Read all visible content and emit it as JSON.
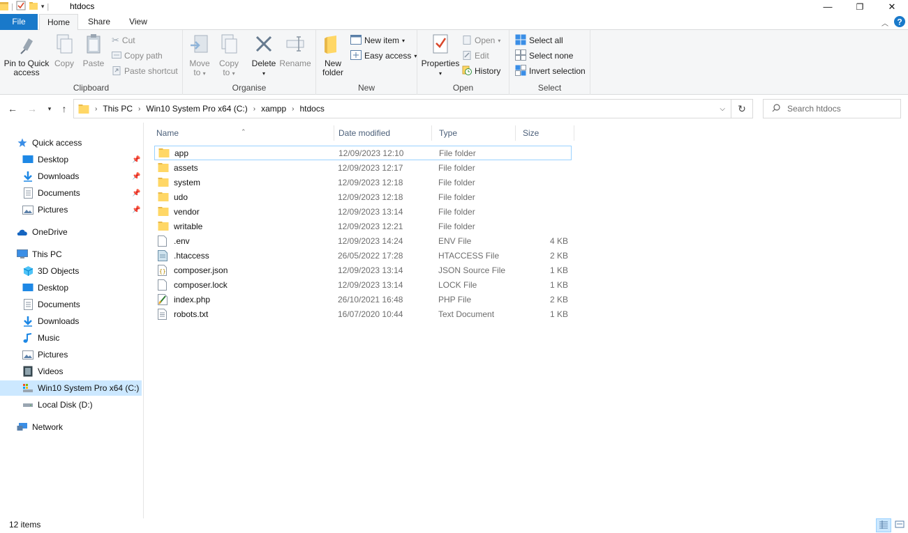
{
  "window": {
    "title": "htdocs",
    "minimize_glyph": "—",
    "maximize_glyph": "❐",
    "close_glyph": "✕"
  },
  "ribbon_tabs": {
    "file": "File",
    "home": "Home",
    "share": "Share",
    "view": "View"
  },
  "ribbon": {
    "clipboard": {
      "label": "Clipboard",
      "pin": [
        "Pin to Quick",
        "access"
      ],
      "copy": "Copy",
      "paste": "Paste",
      "cut": "Cut",
      "copy_path": "Copy path",
      "paste_shortcut": "Paste shortcut"
    },
    "organise": {
      "label": "Organise",
      "move_to": [
        "Move",
        "to"
      ],
      "copy_to": [
        "Copy",
        "to"
      ],
      "delete": "Delete",
      "rename": "Rename"
    },
    "new": {
      "label": "New",
      "new_folder": [
        "New",
        "folder"
      ],
      "new_item": "New item",
      "easy_access": "Easy access"
    },
    "open": {
      "label": "Open",
      "properties": "Properties",
      "open": "Open",
      "edit": "Edit",
      "history": "History"
    },
    "select": {
      "label": "Select",
      "select_all": "Select all",
      "select_none": "Select none",
      "invert_selection": "Invert selection"
    }
  },
  "address": {
    "crumbs": [
      "This PC",
      "Win10 System Pro x64 (C:)",
      "xampp",
      "htdocs"
    ],
    "search_placeholder": "Search htdocs"
  },
  "nav_pane": {
    "quick_access": "Quick access",
    "quick_items": [
      "Desktop",
      "Downloads",
      "Documents",
      "Pictures"
    ],
    "onedrive": "OneDrive",
    "this_pc": "This PC",
    "pc_items": [
      "3D Objects",
      "Desktop",
      "Documents",
      "Downloads",
      "Music",
      "Pictures",
      "Videos",
      "Win10 System Pro x64 (C:)",
      "Local Disk (D:)"
    ],
    "network": "Network"
  },
  "columns": {
    "name": "Name",
    "date": "Date modified",
    "type": "Type",
    "size": "Size"
  },
  "files": [
    {
      "name": "app",
      "date": "12/09/2023 12:10",
      "type": "File folder",
      "size": "",
      "icon": "folder-icon"
    },
    {
      "name": "assets",
      "date": "12/09/2023 12:17",
      "type": "File folder",
      "size": "",
      "icon": "folder-icon"
    },
    {
      "name": "system",
      "date": "12/09/2023 12:18",
      "type": "File folder",
      "size": "",
      "icon": "folder-icon"
    },
    {
      "name": "udo",
      "date": "12/09/2023 12:18",
      "type": "File folder",
      "size": "",
      "icon": "folder-icon"
    },
    {
      "name": "vendor",
      "date": "12/09/2023 13:14",
      "type": "File folder",
      "size": "",
      "icon": "folder-icon"
    },
    {
      "name": "writable",
      "date": "12/09/2023 12:21",
      "type": "File folder",
      "size": "",
      "icon": "folder-icon"
    },
    {
      "name": ".env",
      "date": "12/09/2023 14:24",
      "type": "ENV File",
      "size": "4 KB",
      "icon": "file-icon"
    },
    {
      "name": ".htaccess",
      "date": "26/05/2022 17:28",
      "type": "HTACCESS File",
      "size": "2 KB",
      "icon": "config-file-icon"
    },
    {
      "name": "composer.json",
      "date": "12/09/2023 13:14",
      "type": "JSON Source File",
      "size": "1 KB",
      "icon": "json-file-icon"
    },
    {
      "name": "composer.lock",
      "date": "12/09/2023 13:14",
      "type": "LOCK File",
      "size": "1 KB",
      "icon": "file-icon"
    },
    {
      "name": "index.php",
      "date": "26/10/2021 16:48",
      "type": "PHP File",
      "size": "2 KB",
      "icon": "php-file-icon"
    },
    {
      "name": "robots.txt",
      "date": "16/07/2020 10:44",
      "type": "Text Document",
      "size": "1 KB",
      "icon": "text-file-icon"
    }
  ],
  "status": {
    "count": "12 items"
  },
  "colors": {
    "accent": "#1979ca",
    "selection": "#cce8ff",
    "folder": "#ffd766",
    "focus": "#99d1ff"
  }
}
